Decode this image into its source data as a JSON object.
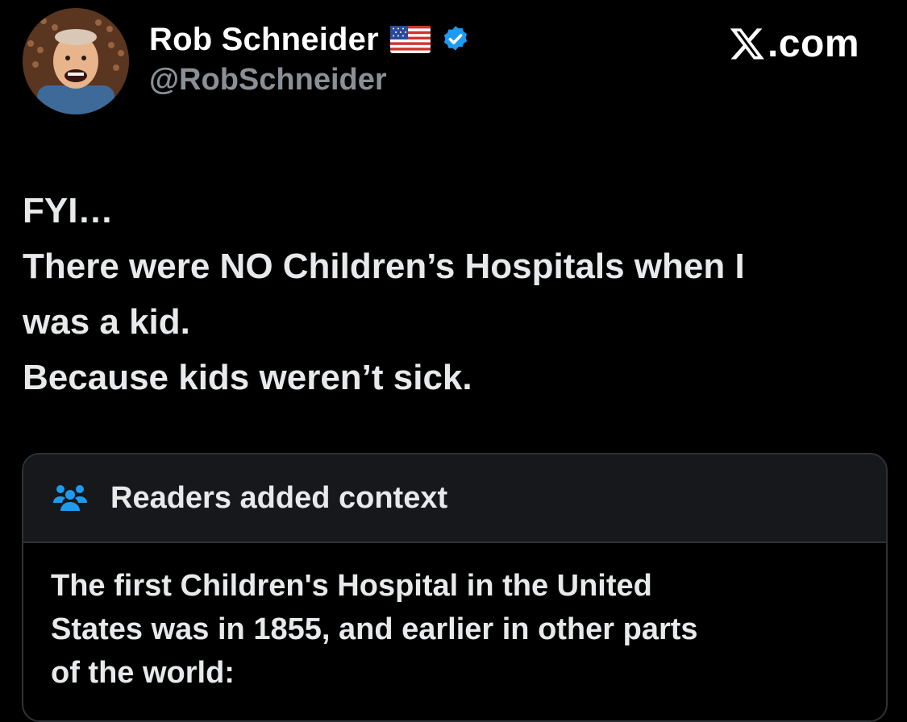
{
  "author": {
    "display_name": "Rob Schneider",
    "handle": "@RobSchneider",
    "avatar_icon": "user-avatar-photo",
    "flag_icon": "us-flag-emoji",
    "verified_icon": "verified-badge-icon"
  },
  "brand": {
    "logo_icon": "x-logo-icon",
    "domain": ".com"
  },
  "post": {
    "lines": [
      "FYI…",
      "There were NO Children’s Hospitals when I",
      "was a kid.",
      "Because kids weren’t sick."
    ]
  },
  "community_note": {
    "icon": "people-icon",
    "title": "Readers added context",
    "body_lines": [
      "The first Children's Hospital in the United",
      "States was in 1855, and earlier in other parts",
      "of the world:"
    ]
  },
  "colors": {
    "background": "#000000",
    "primary_text": "#e7e9ea",
    "secondary_text": "#8b9096",
    "verified_blue": "#1d9bf0",
    "note_header_bg": "#16181c",
    "note_border": "#2f3336"
  }
}
